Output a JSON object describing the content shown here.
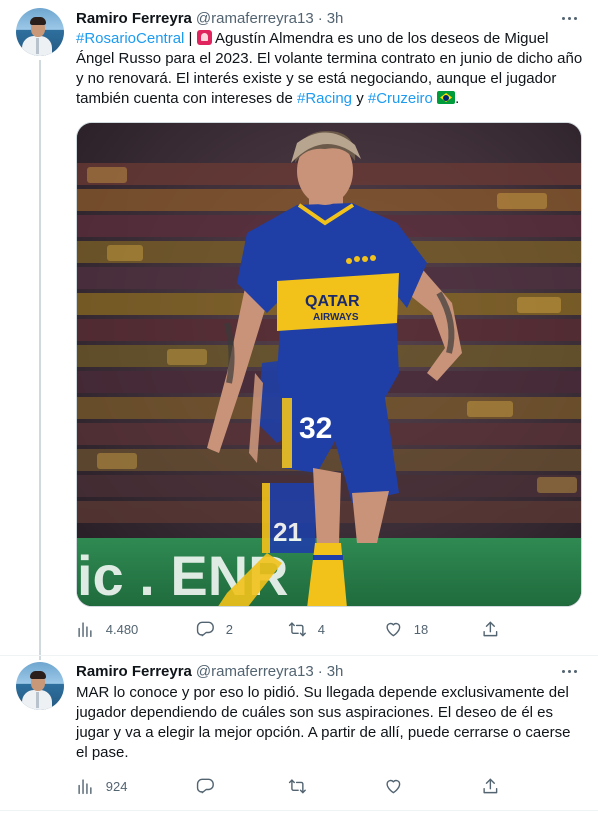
{
  "tweets": [
    {
      "author_name": "Ramiro Ferreyra",
      "author_handle": "@ramaferreyra13",
      "time": "3h",
      "text": {
        "hashtag1": "#RosarioCentral",
        "sep": " | ",
        "part1": " Agustín Almendra es uno de los deseos de Miguel Ángel Russo para el 2023. El volante termina contrato en junio de dicho año y no renovará. El interés existe y se está negociando, aunque el jugador también cuenta con intereses de ",
        "hashtag2": "#Racing",
        "and": " y ",
        "hashtag3": "#Cruzeiro",
        "end": "."
      },
      "image": {
        "shirt_sponsor_line1": "QATAR",
        "shirt_sponsor_line2": "AIRWAYS",
        "shirt_number": "32",
        "teammate_number": "21",
        "banner_text": "ic  .  ENR"
      },
      "stats": {
        "views": "4.480",
        "replies": "2",
        "retweets": "4",
        "likes": "18"
      }
    },
    {
      "author_name": "Ramiro Ferreyra",
      "author_handle": "@ramaferreyra13",
      "time": "3h",
      "text": "MAR lo conoce y por eso lo pidió. Su llegada depende exclusivamente del jugador dependiendo de cuáles son sus aspiraciones. El deseo de él es jugar y va a elegir la mejor opción. A partir de allí, puede cerrarse o caerse el pase.",
      "stats": {
        "views": "924",
        "replies": "",
        "retweets": "",
        "likes": ""
      }
    }
  ],
  "icons": {
    "views": "bar-chart-icon",
    "reply": "speech-bubble-icon",
    "retweet": "retweet-arrows-icon",
    "like": "heart-icon",
    "share": "share-upload-icon",
    "more": "more-dots-icon",
    "siren": "police-siren-emoji",
    "flag": "brazil-flag-emoji"
  },
  "colors": {
    "hashtag": "#1d9bf0",
    "secondary_text": "#536471",
    "boca_blue": "#1f3fa6",
    "boca_gold": "#f2c21b"
  }
}
